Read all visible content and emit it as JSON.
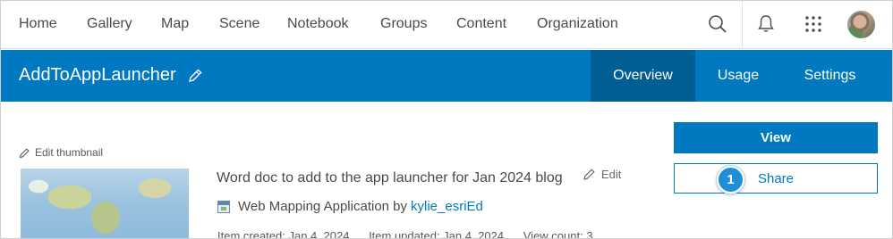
{
  "nav": {
    "links": [
      "Home",
      "Gallery",
      "Map",
      "Scene",
      "Notebook",
      "Groups",
      "Content",
      "Organization"
    ],
    "icons": [
      "search-icon",
      "bell-icon",
      "app-launcher-icon"
    ]
  },
  "header": {
    "title": "AddToAppLauncher",
    "tabs": [
      "Overview",
      "Usage",
      "Settings"
    ],
    "active_tab": "Overview"
  },
  "content": {
    "edit_thumbnail": "Edit thumbnail",
    "description": "Word doc to add to the app launcher for Jan 2024 blog",
    "edit_label": "Edit",
    "item_type": "Web Mapping Application by",
    "owner": "kylie_esriEd",
    "created": "Item created: Jan 4, 2024",
    "updated": "Item updated: Jan 4, 2024",
    "views": "View count: 3"
  },
  "actions": {
    "view_label": "View",
    "share_label": "Share",
    "callout_number": "1"
  },
  "colors": {
    "brand_blue": "#0079c1",
    "active_tab": "#005e95"
  }
}
